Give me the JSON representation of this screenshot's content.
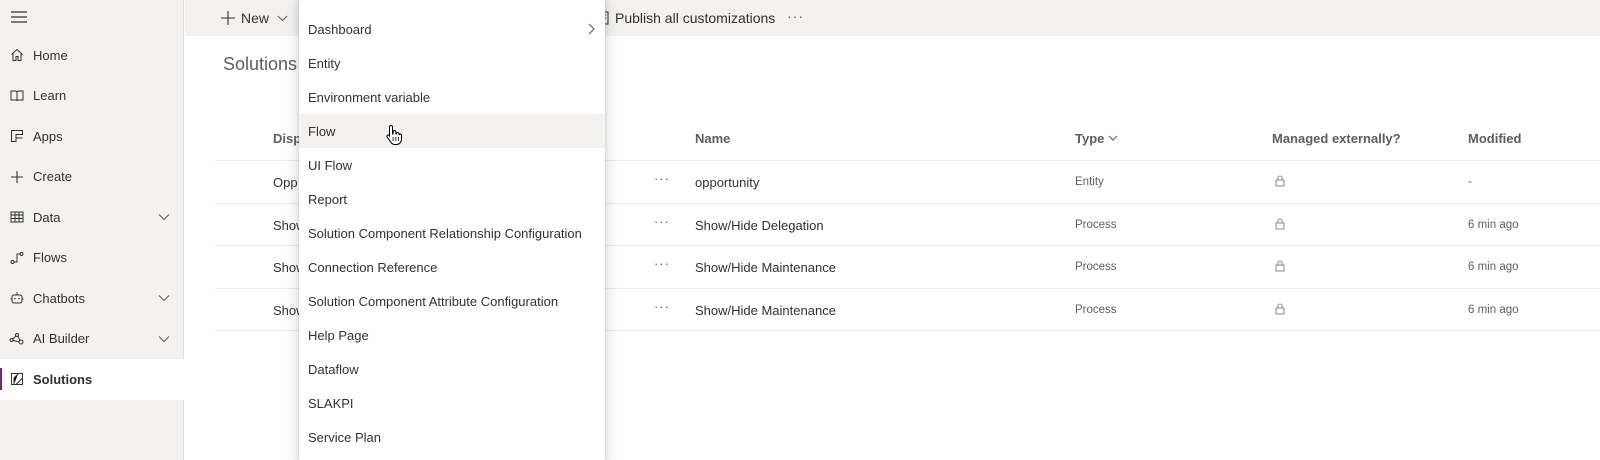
{
  "sidebar": {
    "items": [
      {
        "label": "Home",
        "icon": "home-icon",
        "expandable": false
      },
      {
        "label": "Learn",
        "icon": "book-icon",
        "expandable": false
      },
      {
        "label": "Apps",
        "icon": "apps-icon",
        "expandable": false
      },
      {
        "label": "Create",
        "icon": "plus-icon",
        "expandable": false
      },
      {
        "label": "Data",
        "icon": "table-icon",
        "expandable": true
      },
      {
        "label": "Flows",
        "icon": "flow-icon",
        "expandable": false
      },
      {
        "label": "Chatbots",
        "icon": "bot-icon",
        "expandable": true
      },
      {
        "label": "AI Builder",
        "icon": "ai-builder-icon",
        "expandable": true
      },
      {
        "label": "Solutions",
        "icon": "solutions-icon",
        "expandable": false,
        "active": true
      }
    ]
  },
  "commandbar": {
    "new_label": "New",
    "publish_label": "Publish all customizations",
    "more_label": "···"
  },
  "breadcrumb": "Solutions",
  "table": {
    "headers": {
      "display": "Disp",
      "name": "Name",
      "type": "Type",
      "managed": "Managed externally?",
      "modified": "Modified"
    },
    "rows": [
      {
        "display": "Opp",
        "name": "opportunity",
        "type": "Entity",
        "modified": "-"
      },
      {
        "display": "Show",
        "name": "Show/Hide Delegation",
        "type": "Process",
        "modified": "6 min ago"
      },
      {
        "display": "Show",
        "name": "Show/Hide Maintenance",
        "type": "Process",
        "modified": "6 min ago"
      },
      {
        "display": "Show",
        "name": "Show/Hide Maintenance",
        "type": "Process",
        "modified": "6 min ago"
      }
    ],
    "more_label": "···"
  },
  "new_menu": {
    "items": [
      {
        "label": "Dashboard",
        "has_submenu": true
      },
      {
        "label": "Entity"
      },
      {
        "label": "Environment variable"
      },
      {
        "label": "Flow",
        "hovered": true
      },
      {
        "label": "UI Flow"
      },
      {
        "label": "Report"
      },
      {
        "label": "Solution Component Relationship Configuration"
      },
      {
        "label": "Connection Reference"
      },
      {
        "label": "Solution Component Attribute Configuration"
      },
      {
        "label": "Help Page"
      },
      {
        "label": "Dataflow"
      },
      {
        "label": "SLAKPI"
      },
      {
        "label": "Service Plan"
      }
    ]
  },
  "colors": {
    "accent": "#742774",
    "sidebar_bg": "#f3f2f1",
    "hover_bg": "#f3f2f1"
  }
}
